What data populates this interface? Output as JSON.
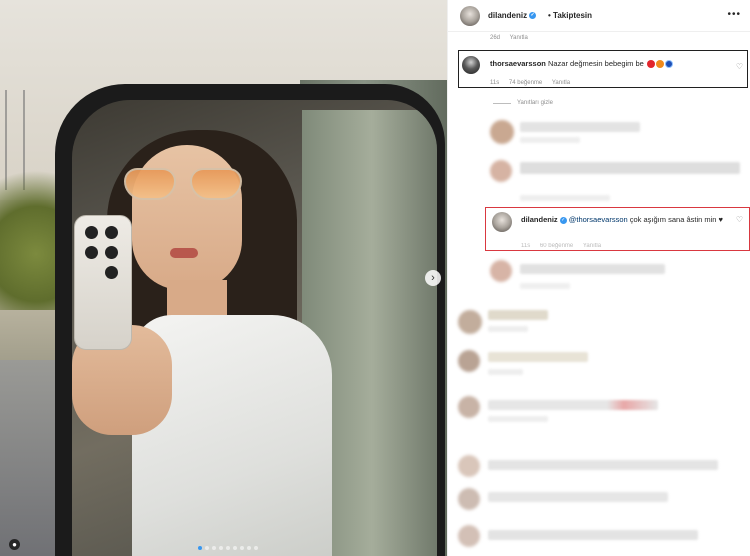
{
  "post": {
    "author": "dilandeniz",
    "follow_label": "Takiptesin",
    "more_label": "•••",
    "top_meta": {
      "time": "26d",
      "reply": "Yanıtla"
    }
  },
  "comments": {
    "highlight": {
      "user": "thorsaevarsson",
      "text": "Nazar değmesin bebegim be",
      "meta": {
        "time": "11s",
        "likes": "74 beğenme",
        "reply": "Yanıtla"
      }
    },
    "view_replies_label": "Yanıtları gizle",
    "reply": {
      "user": "dilandeniz",
      "mention": "@thorsaevarsson",
      "text": "çok aşığım sana âstin min ♥",
      "meta": {
        "time": "11s",
        "likes": "60 beğenme",
        "reply": "Yanıtla"
      }
    }
  },
  "photo": {
    "next_label": "›",
    "tag_icon": "person-tag-icon"
  },
  "colors": {
    "accent": "#3897f0",
    "highlight_red": "#d93840",
    "box_black": "#202020"
  }
}
